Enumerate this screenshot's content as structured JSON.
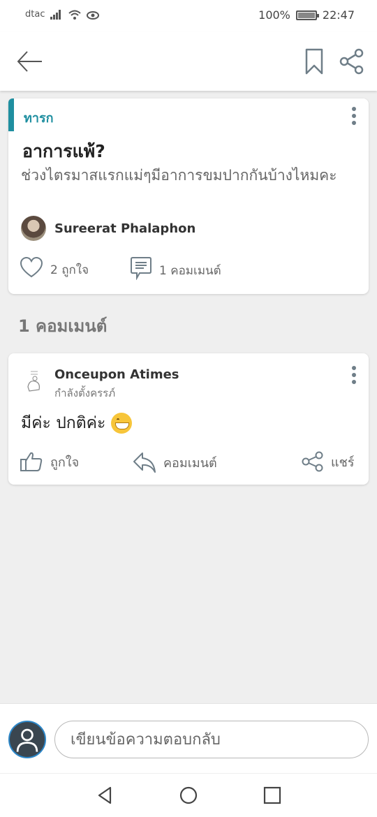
{
  "status_bar": {
    "carrier": "dtac",
    "battery": "100%",
    "time": "22:47"
  },
  "app_bar": {
    "back_icon": "arrow-left-icon",
    "bookmark_icon": "bookmark-icon",
    "share_icon": "share-icon"
  },
  "post": {
    "category": "ทารก",
    "title": "อาการแพ้?",
    "body": "ช่วงไตรมาสแรกแม่ๆมีอาการขมปากกันบ้างไหมคะ",
    "author": "Sureerat Phalaphon",
    "likes_label": "2 ถูกใจ",
    "comments_label": "1 คอมเมนต์"
  },
  "comments_heading": "1 คอมเมนต์",
  "comments": [
    {
      "author": "Onceupon Atimes",
      "status": "กำลังตั้งครรภ์",
      "text": "มีค่ะ ปกติค่ะ",
      "like_label": "ถูกใจ",
      "reply_label": "คอมเมนต์",
      "share_label": "แชร์"
    }
  ],
  "composer": {
    "placeholder": "เขียนข้อความตอบกลับ"
  },
  "colors": {
    "accent": "#1f8fa0",
    "background": "#efefef",
    "card": "#ffffff"
  }
}
